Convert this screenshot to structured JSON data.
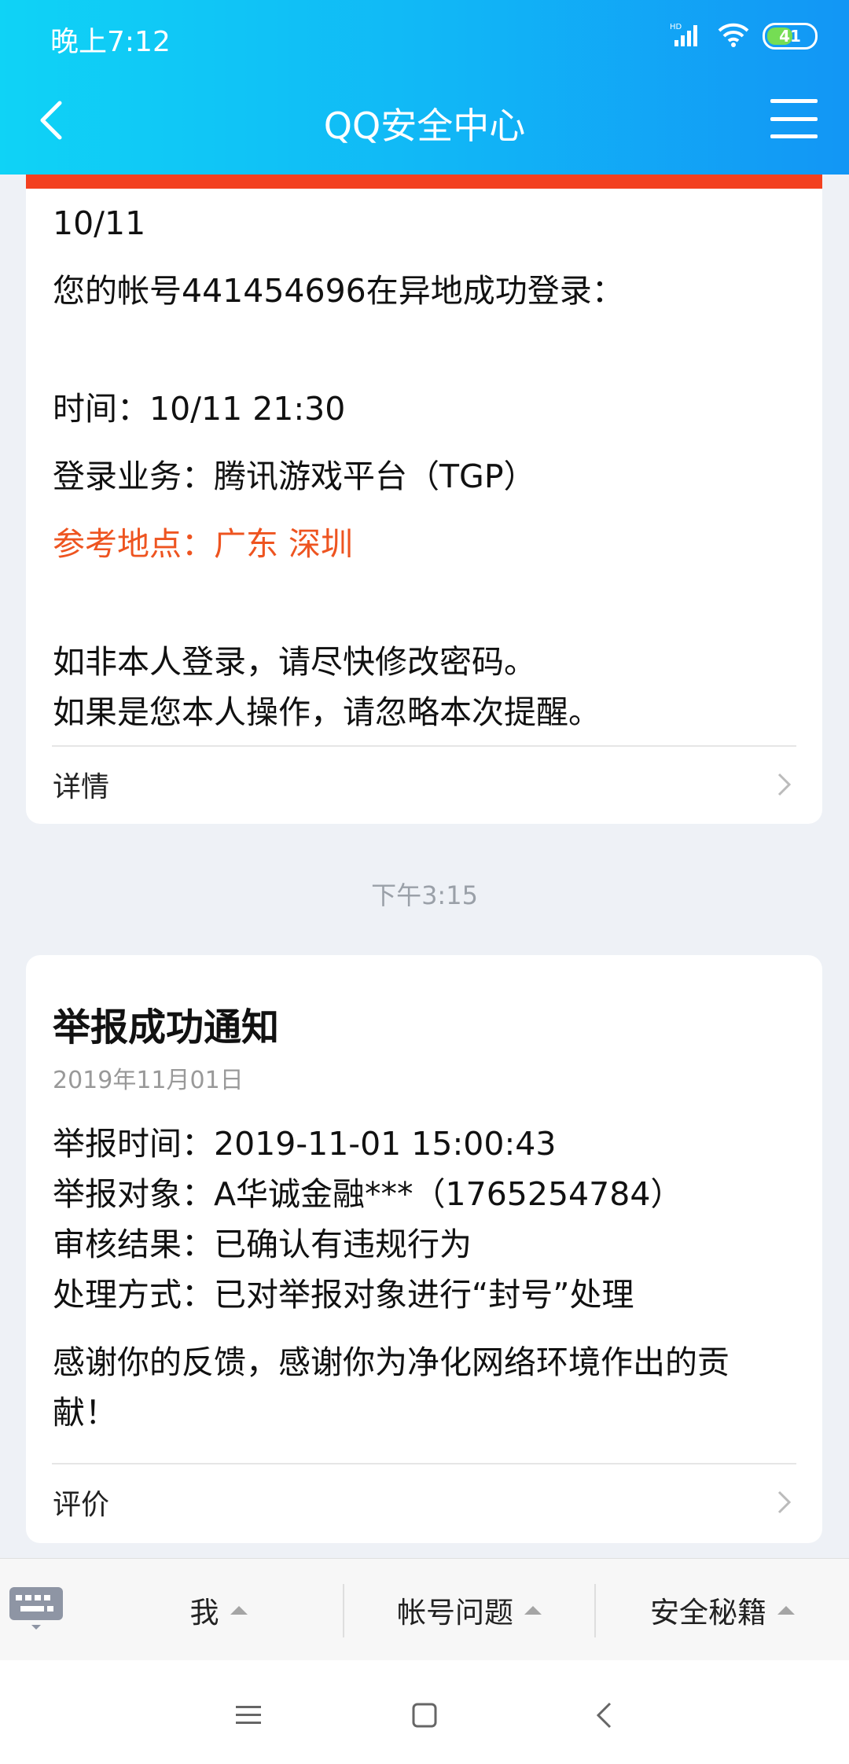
{
  "status_bar": {
    "time": "晚上7:12",
    "battery": "41",
    "network": "HD"
  },
  "header": {
    "title": "QQ安全中心"
  },
  "card1": {
    "date": "10/11",
    "lines": [
      "您的帐号441454696在异地成功登录：",
      "时间：10/11 21:30",
      "登录业务：腾讯游戏平台（TGP）",
      "参考地点：广东 深圳",
      "如非本人登录，请尽快修改密码。",
      "如果是您本人操作，请忽略本次提醒。"
    ],
    "detail_label": "详情"
  },
  "timestamp": "下午3:15",
  "card2": {
    "title": "举报成功通知",
    "date": "2019年11月01日",
    "lines": [
      "举报时间：2019-11-01 15:00:43",
      "举报对象：A华诚金融***（1765254784）",
      "审核结果：已确认有违规行为",
      "处理方式：已对举报对象进行“封号”处理",
      "感谢你的反馈，感谢你为净化网络环境作出的贡",
      "献！"
    ],
    "rate_label": "评价"
  },
  "bottom_tabs": [
    "我",
    "帐号问题",
    "安全秘籍"
  ],
  "colors": {
    "header_start": "#0fd3f6",
    "header_end": "#1296f5",
    "alert_red": "#f3401f",
    "location_orange": "#ee5420"
  }
}
